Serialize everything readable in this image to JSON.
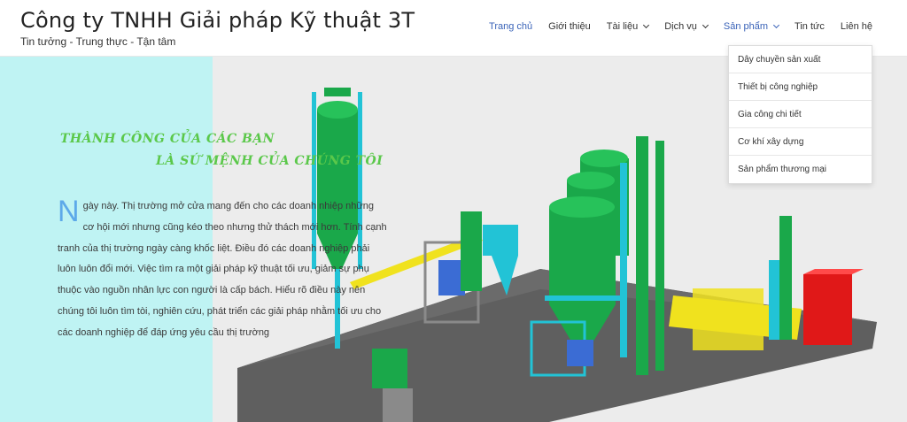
{
  "header": {
    "site_title": "Công ty TNHH Giải pháp Kỹ thuật 3T",
    "tagline": "Tin tưởng - Trung thực - Tận tâm"
  },
  "nav": {
    "items": [
      {
        "label": "Trang chủ"
      },
      {
        "label": "Giới thiệu"
      },
      {
        "label": "Tài liệu"
      },
      {
        "label": "Dịch vụ"
      },
      {
        "label": "Sản phẩm"
      },
      {
        "label": "Tin tức"
      },
      {
        "label": "Liên hệ"
      }
    ]
  },
  "dropdown": {
    "items": [
      {
        "label": "Dây chuyền sản xuất"
      },
      {
        "label": "Thiết bị công nghiệp"
      },
      {
        "label": "Gia công chi tiết"
      },
      {
        "label": "Cơ khí xây dựng"
      },
      {
        "label": "Sản phẩm thương mại"
      }
    ]
  },
  "hero": {
    "slogan_line1": "THÀNH CÔNG CỦA CÁC BẠN",
    "slogan_line2": "LÀ SỨ MỆNH CỦA CHÚNG TÔI",
    "dropcap": "N",
    "body": "gày này. Thị trường mở cửa mang đến cho các doanh nhiệp những cơ hội mới nhưng cũng kéo theo nhưng thử thách mới hơn. Tính cạnh tranh của thị trường ngày càng khốc liệt. Điều đó các doanh nghiệp phải luôn luôn đổi mới. Việc tìm ra một giải pháp kỹ thuật tối ưu, giảm sự phụ thuộc vào nguồn nhân lực con người là cấp bách. Hiểu rõ điều này nên chúng tôi luôn tìm tòi, nghiên cứu, phát triển các giải pháp nhằm tối ưu cho các doanh nghiệp để đáp ứng yêu cầu thị trường"
  },
  "colors": {
    "accent_blue": "#3a63b8",
    "slogan_green": "#5bc84a",
    "cyan_panel": "#bff3f3",
    "machine_green": "#1aa84a",
    "machine_cyan": "#22c3d6",
    "machine_yellow": "#f0e21e",
    "machine_red": "#e01818"
  }
}
